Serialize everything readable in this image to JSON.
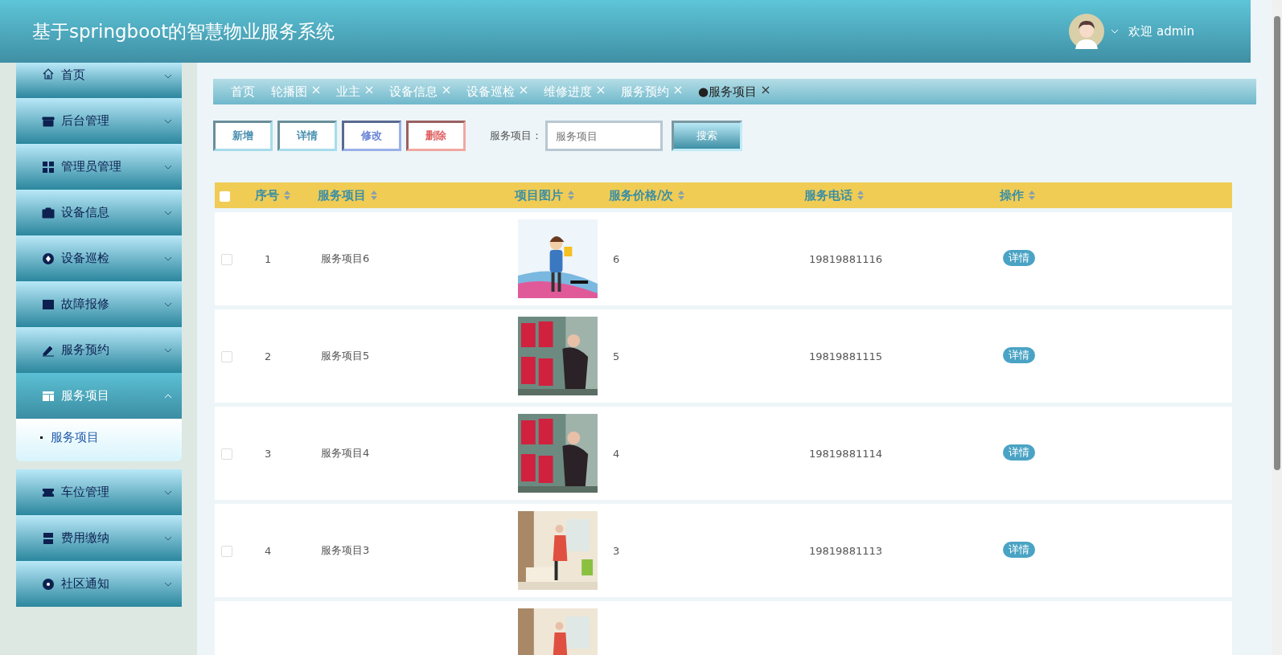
{
  "header": {
    "title": "基于springboot的智慧物业服务系统",
    "user_menu": "欢迎 admin"
  },
  "sidebar": {
    "items": [
      {
        "label": "首页",
        "expanded": false
      },
      {
        "label": "后台管理",
        "expanded": false
      },
      {
        "label": "管理员管理",
        "expanded": false
      },
      {
        "label": "设备信息",
        "expanded": false
      },
      {
        "label": "设备巡检",
        "expanded": false
      },
      {
        "label": "故障报修",
        "expanded": false
      },
      {
        "label": "服务预约",
        "expanded": false
      },
      {
        "label": "服务项目",
        "expanded": true,
        "children": [
          {
            "label": "服务项目",
            "selected": true
          }
        ]
      },
      {
        "label": "车位管理",
        "expanded": false
      },
      {
        "label": "费用缴纳",
        "expanded": false
      },
      {
        "label": "社区通知",
        "expanded": false
      }
    ]
  },
  "tabs": [
    {
      "label": "首页",
      "closable": false,
      "selected": false
    },
    {
      "label": "轮播图",
      "closable": true,
      "selected": false
    },
    {
      "label": "业主",
      "closable": true,
      "selected": false
    },
    {
      "label": "设备信息",
      "closable": true,
      "selected": false
    },
    {
      "label": "设备巡检",
      "closable": true,
      "selected": false
    },
    {
      "label": "维修进度",
      "closable": true,
      "selected": false
    },
    {
      "label": "服务预约",
      "closable": true,
      "selected": false
    },
    {
      "label": "●服务项目",
      "closable": true,
      "selected": true
    }
  ],
  "toolbar": {
    "buttons": [
      {
        "label": "新增",
        "kind": "add"
      },
      {
        "label": "详情",
        "kind": "detail"
      },
      {
        "label": "修改",
        "kind": "edit"
      },
      {
        "label": "删除",
        "kind": "delete"
      }
    ],
    "search_label": "服务项目：",
    "search_placeholder": "服务项目",
    "search_button": "搜索"
  },
  "table": {
    "select_all_checked": false,
    "columns": [
      "序号",
      "服务项目",
      "项目图片",
      "服务价格/次",
      "服务电话",
      "操作"
    ],
    "rows": [
      {
        "checked": false,
        "no": "1",
        "name": "服务项目6",
        "image": {
          "kind": "picture"
        },
        "price": "6",
        "phone": "19819881116",
        "action": "详情"
      },
      {
        "checked": false,
        "no": "2",
        "name": "服务项目5",
        "image": {
          "kind": "picture"
        },
        "price": "5",
        "phone": "19819881115",
        "action": "详情"
      },
      {
        "checked": false,
        "no": "3",
        "name": "服务项目4",
        "image": {
          "kind": "picture"
        },
        "price": "4",
        "phone": "19819881114",
        "action": "详情"
      },
      {
        "checked": false,
        "no": "4",
        "name": "服务项目3",
        "image": {
          "kind": "picture"
        },
        "price": "3",
        "phone": "19819881113",
        "action": "详情"
      },
      {
        "image": {
          "kind": "picture"
        }
      }
    ]
  }
}
